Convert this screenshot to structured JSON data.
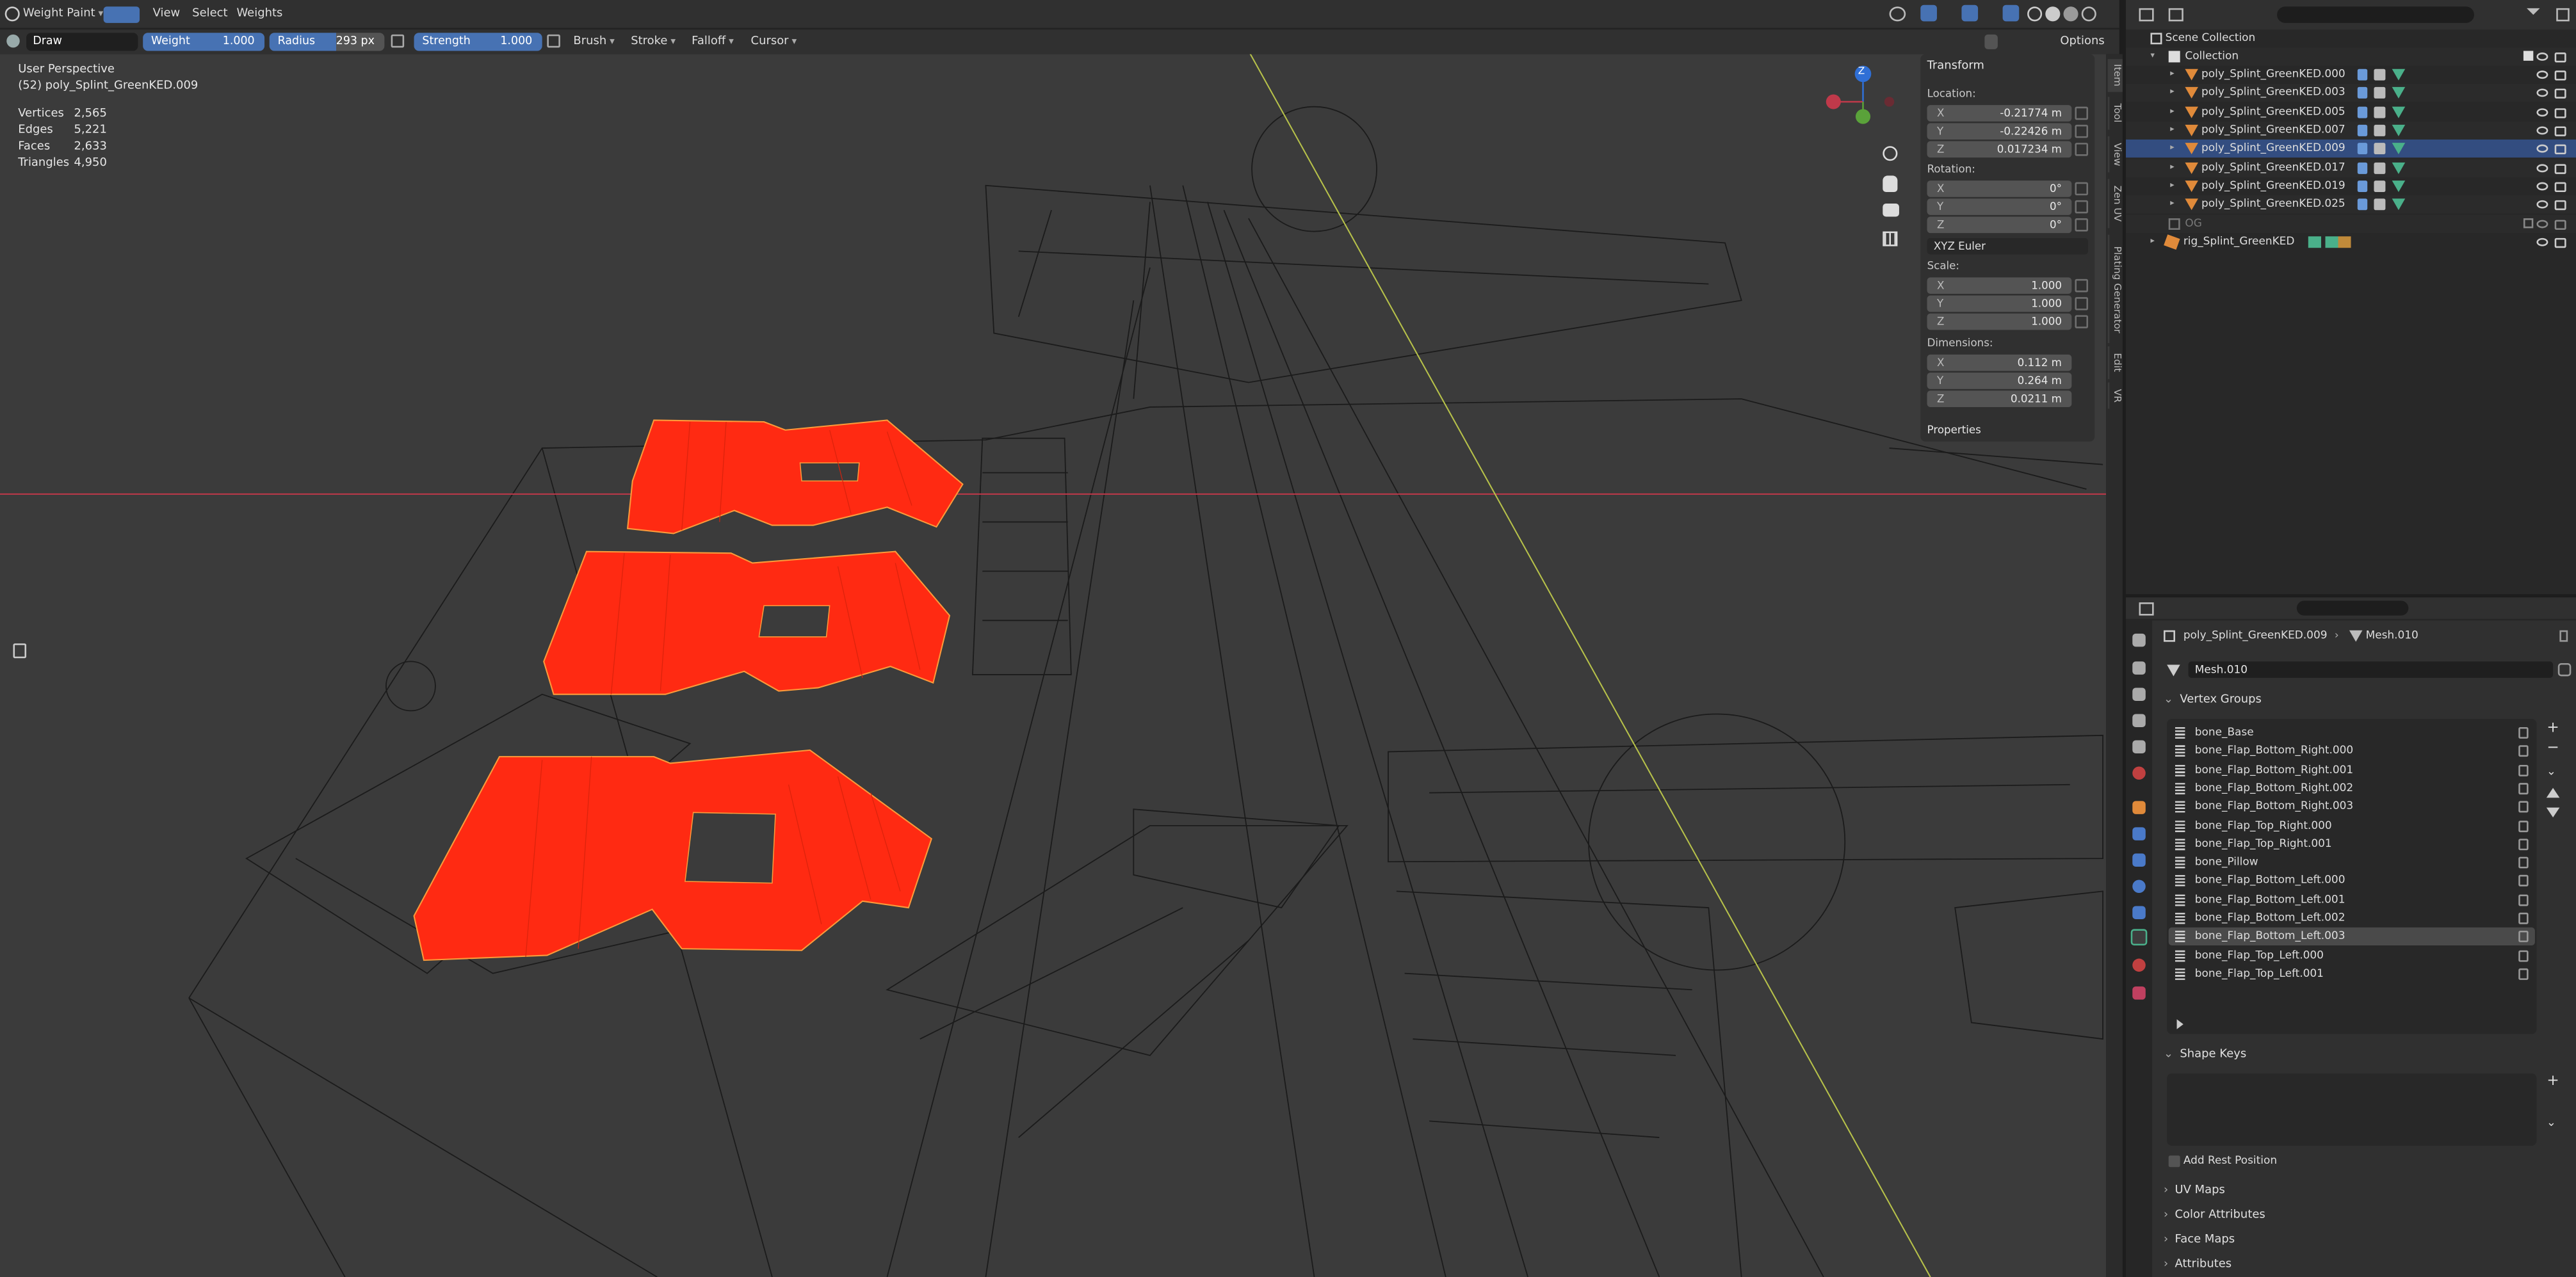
{
  "header": {
    "mode": "Weight Paint",
    "menus": [
      "View",
      "Select",
      "Weights"
    ]
  },
  "toolbar": {
    "brush_name": "Draw",
    "weight_label": "Weight",
    "weight_value": "1.000",
    "radius_label": "Radius",
    "radius_value": "293 px",
    "strength_label": "Strength",
    "strength_value": "1.000",
    "menus": [
      "Brush",
      "Stroke",
      "Falloff",
      "Cursor"
    ],
    "options": "Options"
  },
  "viewport": {
    "perspective": "User Perspective",
    "object": "(52) poly_Splint_GreenKED.009",
    "stats": [
      {
        "k": "Vertices",
        "v": "2,565"
      },
      {
        "k": "Edges",
        "v": "5,221"
      },
      {
        "k": "Faces",
        "v": "2,633"
      },
      {
        "k": "Triangles",
        "v": "4,950"
      }
    ],
    "mesh_color": "#ff2a12",
    "axis_x_color": "#c0394a",
    "axis_y_color": "#b7c24a"
  },
  "gizmo": {
    "z": "Z"
  },
  "side_tabs": [
    "Item",
    "Tool",
    "View",
    "Zen UV",
    "Plating Generator",
    "Edit",
    "VR"
  ],
  "transform": {
    "title": "Transform",
    "location_label": "Location:",
    "location": {
      "X": "-0.21774 m",
      "Y": "-0.22426 m",
      "Z": "0.017234 m"
    },
    "rotation_label": "Rotation:",
    "rotation": {
      "X": "0°",
      "Y": "0°",
      "Z": "0°"
    },
    "rotation_mode": "XYZ Euler",
    "scale_label": "Scale:",
    "scale": {
      "X": "1.000",
      "Y": "1.000",
      "Z": "1.000"
    },
    "dimensions_label": "Dimensions:",
    "dimensions": {
      "X": "0.112 m",
      "Y": "0.264 m",
      "Z": "0.0211 m"
    },
    "properties": "Properties"
  },
  "outliner": {
    "root": "Scene Collection",
    "collection": "Collection",
    "items": [
      "poly_Splint_GreenKED.000",
      "poly_Splint_GreenKED.003",
      "poly_Splint_GreenKED.005",
      "poly_Splint_GreenKED.007",
      "poly_Splint_GreenKED.009",
      "poly_Splint_GreenKED.017",
      "poly_Splint_GreenKED.019",
      "poly_Splint_GreenKED.025"
    ],
    "og": "OG",
    "rig": "rig_Splint_GreenKED"
  },
  "properties": {
    "breadcrumb_obj": "poly_Splint_GreenKED.009",
    "breadcrumb_mesh": "Mesh.010",
    "mesh_name": "Mesh.010",
    "vertex_groups_title": "Vertex Groups",
    "vertex_groups": [
      "bone_Base",
      "bone_Flap_Bottom_Right.000",
      "bone_Flap_Bottom_Right.001",
      "bone_Flap_Bottom_Right.002",
      "bone_Flap_Bottom_Right.003",
      "bone_Flap_Top_Right.000",
      "bone_Flap_Top_Right.001",
      "bone_Pillow",
      "bone_Flap_Bottom_Left.000",
      "bone_Flap_Bottom_Left.001",
      "bone_Flap_Bottom_Left.002",
      "bone_Flap_Bottom_Left.003",
      "bone_Flap_Top_Left.000",
      "bone_Flap_Top_Left.001"
    ],
    "selected_group": "bone_Flap_Bottom_Left.003",
    "shape_keys_title": "Shape Keys",
    "add_rest_position": "Add Rest Position",
    "sections": [
      "UV Maps",
      "Color Attributes",
      "Face Maps",
      "Attributes"
    ]
  }
}
